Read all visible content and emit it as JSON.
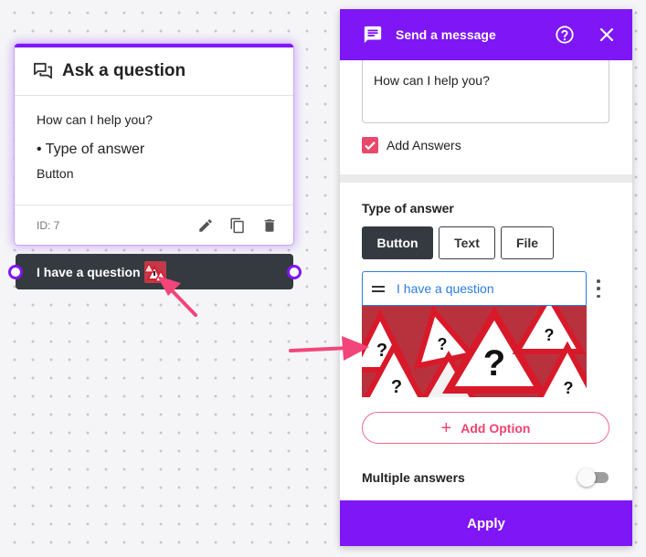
{
  "node_card": {
    "title": "Ask a question",
    "prompt": "How can I help you?",
    "type_label": "• Type of answer",
    "type_value": "Button",
    "id_label": "ID: 7",
    "icons": [
      "question-answer-icon",
      "edit-icon",
      "copy-icon",
      "delete-icon"
    ]
  },
  "answer_bar": {
    "label": "I have a question",
    "thumbnail": "warning-signs-image"
  },
  "panel": {
    "title": "Send a message",
    "icons": [
      "message-icon",
      "help-icon",
      "close-icon"
    ],
    "message_text": "How can I help you?",
    "add_answers_label": "Add Answers",
    "add_answers_checked": true,
    "type_of_answer_label": "Type of answer",
    "type_buttons": [
      "Button",
      "Text",
      "File"
    ],
    "selected_type": "Button",
    "option_value": "I have a question",
    "add_option_label": "Add Option",
    "multiple_answers_label": "Multiple answers",
    "multiple_answers_enabled": false,
    "apply_label": "Apply"
  },
  "colors": {
    "accent": "#7f16f5",
    "pink": "#f0436f",
    "dark": "#343a40",
    "link_blue": "#2c7be5"
  }
}
